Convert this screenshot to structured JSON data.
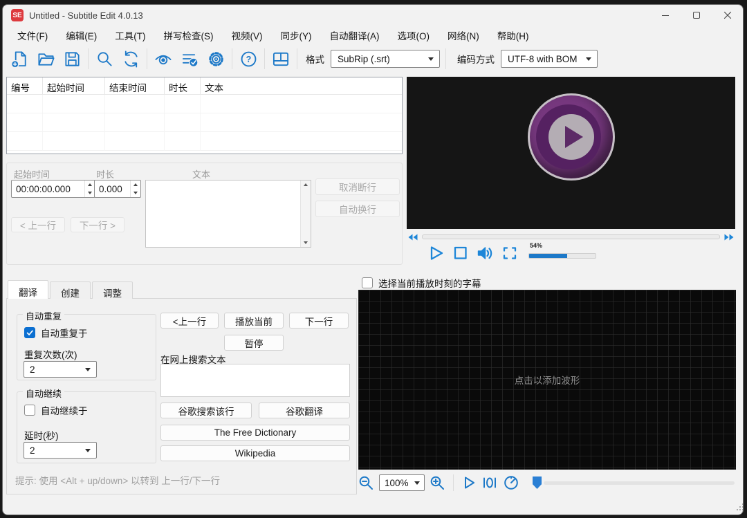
{
  "colors": {
    "accent_blue": "#1d79c8",
    "player_blue": "#1d86d8",
    "logo_red": "#dd3a3e",
    "check_blue": "#0b6fd1"
  },
  "window": {
    "logo_text": "SE",
    "title": "Untitled - Subtitle Edit 4.0.13"
  },
  "menu": {
    "items": [
      "文件(F)",
      "编辑(E)",
      "工具(T)",
      "拼写检查(S)",
      "视频(V)",
      "同步(Y)",
      "自动翻译(A)",
      "选项(O)",
      "网络(N)",
      "帮助(H)"
    ]
  },
  "toolbar": {
    "format_label": "格式",
    "format_value": "SubRip (.srt)",
    "encoding_label": "编码方式",
    "encoding_value": "UTF-8 with BOM"
  },
  "list": {
    "columns": [
      "编号",
      "起始时间",
      "结束时间",
      "时长",
      "文本"
    ]
  },
  "editor": {
    "start_time_label": "起始时间",
    "start_time_value": "00:00:00.000",
    "duration_label": "时长",
    "duration_value": "0.000",
    "text_label": "文本",
    "unbreak_button": "取消断行",
    "auto_break_button": "自动换行",
    "prev_button": "< 上一行",
    "next_button": "下一行 >"
  },
  "video": {
    "volume_percent": "54%"
  },
  "tabs": {
    "items": [
      "翻译",
      "创建",
      "调整"
    ]
  },
  "translate": {
    "auto_repeat_group": "自动重复",
    "auto_repeat_check": "自动重复于",
    "repeat_count_label": "重复次数(次)",
    "repeat_count_value": "2",
    "auto_continue_group": "自动继续",
    "auto_continue_check": "自动继续于",
    "delay_label": "延时(秒)",
    "delay_value": "2",
    "hint": "提示: 使用 <Alt + up/down> 以转到 上一行/下一行",
    "prev_button": "<上一行",
    "play_current_button": "播放当前",
    "next_button": "下一行",
    "pause_button": "暂停",
    "search_group": "在网上搜索文本",
    "google_search_button": "谷歌搜索该行",
    "google_translate_button": "谷歌翻译",
    "free_dictionary_button": "The Free Dictionary",
    "wikipedia_button": "Wikipedia"
  },
  "waveform": {
    "select_label": "选择当前播放时刻的字幕",
    "placeholder": "点击以添加波形",
    "zoom_value": "100%"
  }
}
